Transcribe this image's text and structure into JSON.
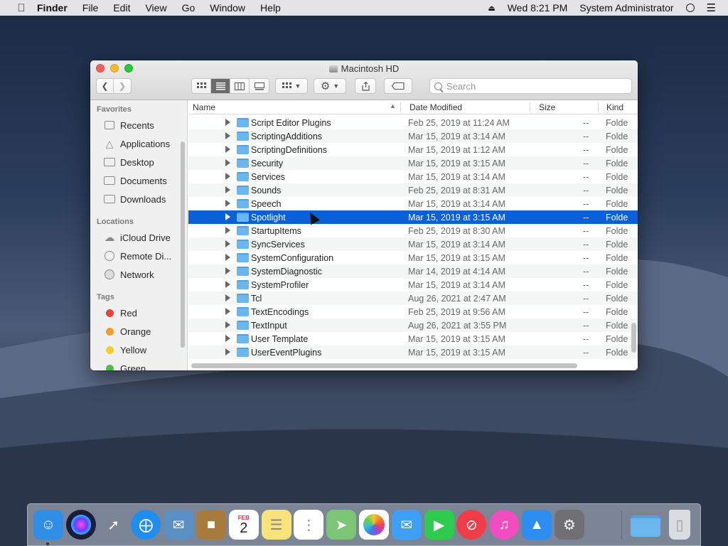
{
  "menubar": {
    "app": "Finder",
    "items": [
      "File",
      "Edit",
      "View",
      "Go",
      "Window",
      "Help"
    ],
    "clock": "Wed 8:21 PM",
    "user": "System Administrator"
  },
  "window": {
    "title": "Macintosh HD",
    "search_placeholder": "Search"
  },
  "sidebar": {
    "favorites_header": "Favorites",
    "favorites": [
      "Recents",
      "Applications",
      "Desktop",
      "Documents",
      "Downloads"
    ],
    "locations_header": "Locations",
    "locations": [
      "iCloud Drive",
      "Remote Di...",
      "Network"
    ],
    "tags_header": "Tags",
    "tags": [
      {
        "label": "Red",
        "color": "#e8403a"
      },
      {
        "label": "Orange",
        "color": "#f39c2e"
      },
      {
        "label": "Yellow",
        "color": "#f5ce27"
      },
      {
        "label": "Green",
        "color": "#4dbe4a"
      }
    ]
  },
  "columns": {
    "name": "Name",
    "date": "Date Modified",
    "size": "Size",
    "kind": "Kind"
  },
  "files": [
    {
      "name": "Script Editor Plugins",
      "date": "Feb 25, 2019 at 11:24 AM",
      "size": "--",
      "kind": "Folde"
    },
    {
      "name": "ScriptingAdditions",
      "date": "Mar 15, 2019 at 3:14 AM",
      "size": "--",
      "kind": "Folde"
    },
    {
      "name": "ScriptingDefinitions",
      "date": "Mar 15, 2019 at 1:12 AM",
      "size": "--",
      "kind": "Folde"
    },
    {
      "name": "Security",
      "date": "Mar 15, 2019 at 3:15 AM",
      "size": "--",
      "kind": "Folde"
    },
    {
      "name": "Services",
      "date": "Mar 15, 2019 at 3:14 AM",
      "size": "--",
      "kind": "Folde"
    },
    {
      "name": "Sounds",
      "date": "Feb 25, 2019 at 8:31 AM",
      "size": "--",
      "kind": "Folde"
    },
    {
      "name": "Speech",
      "date": "Mar 15, 2019 at 3:14 AM",
      "size": "--",
      "kind": "Folde"
    },
    {
      "name": "Spotlight",
      "date": "Mar 15, 2019 at 3:15 AM",
      "size": "--",
      "kind": "Folde",
      "selected": true
    },
    {
      "name": "StartupItems",
      "date": "Feb 25, 2019 at 8:30 AM",
      "size": "--",
      "kind": "Folde"
    },
    {
      "name": "SyncServices",
      "date": "Mar 15, 2019 at 3:14 AM",
      "size": "--",
      "kind": "Folde"
    },
    {
      "name": "SystemConfiguration",
      "date": "Mar 15, 2019 at 3:15 AM",
      "size": "--",
      "kind": "Folde"
    },
    {
      "name": "SystemDiagnostic",
      "date": "Mar 14, 2019 at 4:14 AM",
      "size": "--",
      "kind": "Folde"
    },
    {
      "name": "SystemProfiler",
      "date": "Mar 15, 2019 at 3:14 AM",
      "size": "--",
      "kind": "Folde"
    },
    {
      "name": "Tcl",
      "date": "Aug 26, 2021 at 2:47 AM",
      "size": "--",
      "kind": "Folde"
    },
    {
      "name": "TextEncodings",
      "date": "Feb 25, 2019 at 9:56 AM",
      "size": "--",
      "kind": "Folde"
    },
    {
      "name": "TextInput",
      "date": "Aug 26, 2021 at 3:55 PM",
      "size": "--",
      "kind": "Folde"
    },
    {
      "name": "User Template",
      "date": "Mar 15, 2019 at 3:15 AM",
      "size": "--",
      "kind": "Folde"
    },
    {
      "name": "UserEventPlugins",
      "date": "Mar 15, 2019 at 3:15 AM",
      "size": "--",
      "kind": "Folde"
    }
  ],
  "dock": {
    "calendar_month": "FEB",
    "calendar_day": "2",
    "apps": [
      {
        "name": "finder-icon",
        "color": "#2f8fe8"
      },
      {
        "name": "siri-icon",
        "color": "#1c1c3a"
      },
      {
        "name": "launchpad-icon",
        "color": "#7c8595"
      },
      {
        "name": "safari-icon",
        "color": "#1f8ef0"
      },
      {
        "name": "mail-icon",
        "color": "#5a8fc4"
      },
      {
        "name": "contacts-icon",
        "color": "#a87b3d"
      },
      {
        "name": "calendar-icon",
        "color": "#ffffff"
      },
      {
        "name": "notes-icon",
        "color": "#f7e37a"
      },
      {
        "name": "reminders-icon",
        "color": "#ffffff"
      },
      {
        "name": "maps-icon",
        "color": "#7cc576"
      },
      {
        "name": "photos-icon",
        "color": "#ffffff"
      },
      {
        "name": "messages-icon",
        "color": "#3ea0f5"
      },
      {
        "name": "facetime-icon",
        "color": "#2fcb4f"
      },
      {
        "name": "news-icon",
        "color": "#f23c48"
      },
      {
        "name": "itunes-icon",
        "color": "#f04ec0"
      },
      {
        "name": "app-store-icon",
        "color": "#2c8ef2"
      },
      {
        "name": "system-preferences-icon",
        "color": "#6f6f74"
      },
      {
        "name": "downloads-folder-icon",
        "color": "#6bb6ef"
      },
      {
        "name": "trash-icon",
        "color": "#d9dde2"
      }
    ]
  }
}
